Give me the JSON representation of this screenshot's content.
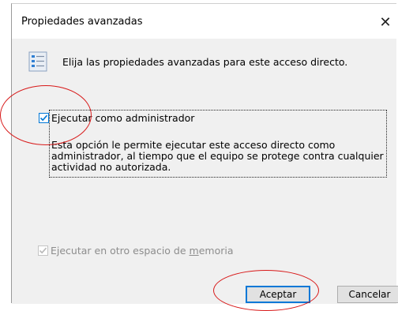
{
  "dialog": {
    "title": "Propiedades avanzadas",
    "close_glyph": "✕"
  },
  "header": {
    "icon": "properties-list-icon",
    "text": "Elija las propiedades avanzadas para este acceso directo."
  },
  "run_as_admin": {
    "label": "Ejecutar como administrador",
    "mnemonic": "E",
    "checked": true,
    "description": "Esta opción le permite ejecutar este acceso directo como administrador, al tiempo que el equipo se protege contra cualquier actividad no autorizada."
  },
  "separate_memory": {
    "label_before": "Ejecutar en otro espacio de ",
    "label_mnemonic": "m",
    "label_after": "emoria",
    "checked": true,
    "disabled": true
  },
  "buttons": {
    "ok": "Aceptar",
    "cancel": "Cancelar"
  },
  "colors": {
    "accent": "#0078d7",
    "annotation": "#d81a1a",
    "client_bg": "#f0f0f0"
  }
}
